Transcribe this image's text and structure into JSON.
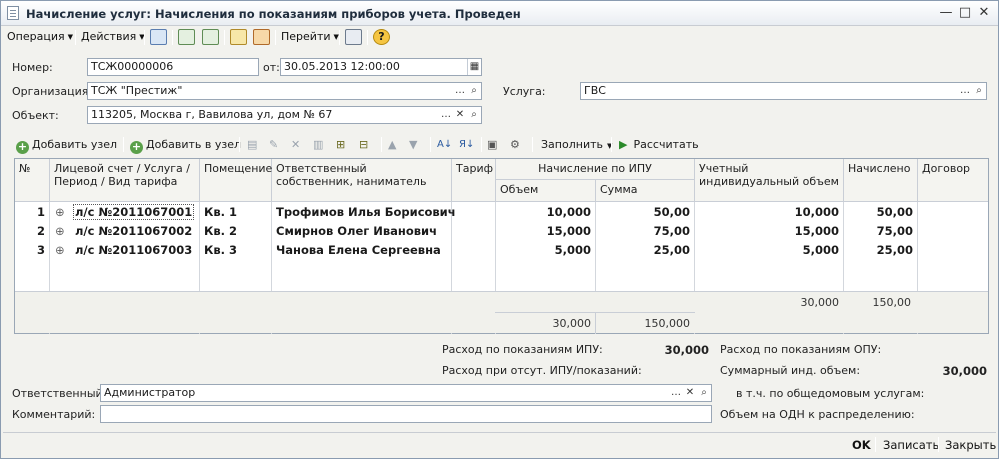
{
  "title": "Начисление услуг: Начисления по показаниям приборов учета. Проведен",
  "menu": {
    "operation": "Операция",
    "actions": "Действия",
    "goto": "Перейти"
  },
  "form": {
    "number_label": "Номер:",
    "number_value": "ТСЖ00000006",
    "date_label": "от:",
    "date_value": "30.05.2013 12:00:00",
    "org_label": "Организация:",
    "org_value": "ТСЖ \"Престиж\"",
    "service_label": "Услуга:",
    "service_value": "ГВС",
    "object_label": "Объект:",
    "object_value": "113205, Москва г, Вавилова ул, дом № 67"
  },
  "table_toolbar": {
    "add_node": "Добавить узел",
    "add_in_node": "Добавить в узел",
    "fill": "Заполнить",
    "calculate": "Рассчитать"
  },
  "table": {
    "headers": {
      "n": "№",
      "account": "Лицевой счет / Услуга / Период / Вид тарифа",
      "room": "Помещение",
      "owner": "Ответственный собственник, наниматель",
      "tariff": "Тариф",
      "ipu": "Начисление по ИПУ",
      "volume": "Объем",
      "sum": "Сумма",
      "ind_volume": "Учетный индивидуальный объем",
      "accrued": "Начислено",
      "contract": "Договор"
    },
    "rows": [
      {
        "n": "1",
        "account": "л/с №2011067001",
        "room": "Кв. 1",
        "owner": "Трофимов Илья Борисович",
        "volume": "10,000",
        "sum": "50,00",
        "ind_volume": "10,000",
        "accrued": "50,00"
      },
      {
        "n": "2",
        "account": "л/с №2011067002",
        "room": "Кв. 2",
        "owner": "Смирнов Олег Иванович",
        "volume": "15,000",
        "sum": "75,00",
        "ind_volume": "15,000",
        "accrued": "75,00"
      },
      {
        "n": "3",
        "account": "л/с №2011067003",
        "room": "Кв. 3",
        "owner": "Чанова Елена Сергеевна",
        "volume": "5,000",
        "sum": "25,00",
        "ind_volume": "5,000",
        "accrued": "25,00"
      }
    ],
    "totals": {
      "ind_volume": "30,000",
      "accrued": "150,00",
      "volume": "30,000",
      "sum": "150,000"
    }
  },
  "summary": {
    "ipu_label": "Расход по показаниям ИПУ:",
    "ipu_value": "30,000",
    "opu_label": "Расход по показаниям ОПУ:",
    "absent_label": "Расход при отсут. ИПУ/показаний:",
    "total_ind_label": "Суммарный инд. объем:",
    "total_ind_value": "30,000",
    "common_label": "в т.ч. по общедомовым услугам:",
    "odn_label": "Объем на ОДН к распределению:"
  },
  "bottom": {
    "responsible_label": "Ответственный:",
    "responsible_value": "Администратор",
    "comment_label": "Комментарий:",
    "ok": "OK",
    "save": "Записать",
    "close": "Закрыть"
  }
}
